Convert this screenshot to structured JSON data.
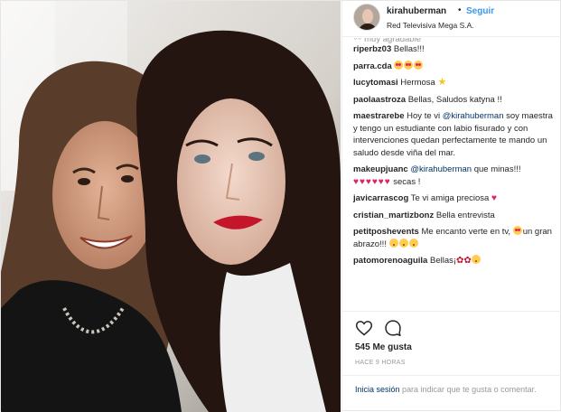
{
  "post": {
    "username": "kirahuberman",
    "separator": "•",
    "follow_label": "Seguir",
    "location": "Red Televisiva Mega S.A.",
    "comments": [
      {
        "user": "riperbz03",
        "text": "Bellas!!!"
      },
      {
        "user": "parra.cda",
        "text": ""
      },
      {
        "user": "lucytomasi",
        "text": "Hermosa"
      },
      {
        "user": "paolaastroza",
        "text": "Bellas, Saludos katyna !!"
      },
      {
        "user": "maestrarebe",
        "text": "Hoy te vi ",
        "mention": "@kirahuberman",
        "text_after": " soy maestra y tengo un estudiante con labio fisurado y con intervenciones quedan perfectamente te mando un saludo desde viña del mar."
      },
      {
        "user": "makeupjuanc",
        "mention": "@kirahuberman",
        "text_after": " que minas!!!",
        "text_after2": " secas !"
      },
      {
        "user": "javicarrascog",
        "text": "Te vi amiga preciosa"
      },
      {
        "user": "cristian_martizbonz",
        "text": "Bella entrevista"
      },
      {
        "user": "petitposhevents",
        "text": "Me encanto verte en tv, ",
        "text2": "un gran abrazo!!!"
      },
      {
        "user": "patomorenoaguila",
        "text": "Bellas¡"
      }
    ],
    "likes": "545 Me gusta",
    "time": "HACE 9 HORAS",
    "footer_login": "Inicia sesión",
    "footer_text": " para indicar que te gusta o comentar.",
    "icons": {
      "like": "heart-outline-icon",
      "comment": "speech-bubble-icon",
      "star": "star-emoji-icon",
      "heart": "red-heart-emoji-icon",
      "rose": "rose-emoji-icon",
      "heart_eyes": "heart-eyes-emoji-icon",
      "kiss": "kissing-face-emoji-icon"
    },
    "colors": {
      "link_blue": "#3897f0",
      "mention_blue": "#003569",
      "text": "#262626",
      "muted": "#999999",
      "heart_red": "#e0245e"
    }
  }
}
